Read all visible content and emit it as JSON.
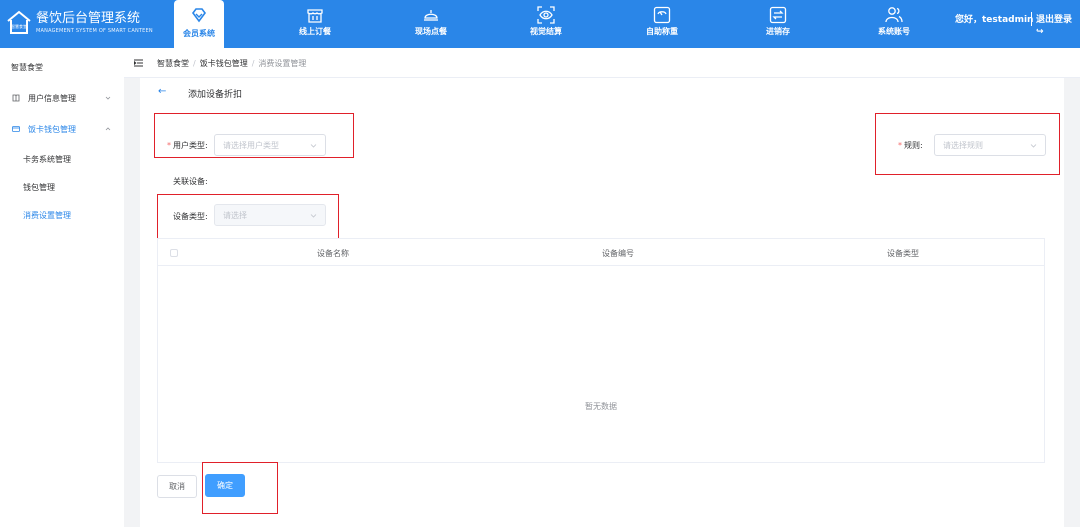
{
  "header": {
    "title": "餐饮后台管理系统",
    "subtitle": "MANAGEMENT SYSTEM OF SMART CANTEEN",
    "logo_text": "智慧食堂",
    "nav": [
      {
        "label": "会员系统",
        "icon": "diamond-icon",
        "active": true
      },
      {
        "label": "线上订餐",
        "icon": "shop-icon"
      },
      {
        "label": "现场点餐",
        "icon": "cloche-icon"
      },
      {
        "label": "视觉结算",
        "icon": "eye-scan-icon"
      },
      {
        "label": "自助称重",
        "icon": "scale-icon"
      },
      {
        "label": "进销存",
        "icon": "exchange-icon"
      },
      {
        "label": "系统账号",
        "icon": "users-icon"
      }
    ],
    "greeting": "您好，testadmin",
    "logout": "退出登录"
  },
  "sidebar": {
    "title": "智慧食堂",
    "items": [
      {
        "label": "用户信息管理",
        "icon": "book-icon",
        "expanded": false
      },
      {
        "label": "饭卡钱包管理",
        "icon": "card-icon",
        "expanded": true
      }
    ],
    "sub_items": [
      "卡务系统管理",
      "钱包管理",
      "消费设置管理"
    ],
    "active_sub": "消费设置管理"
  },
  "breadcrumb": [
    "智慧食堂",
    "饭卡钱包管理",
    "消费设置管理"
  ],
  "page": {
    "title": "添加设备折扣",
    "user_type_label": "用户类型:",
    "user_type_placeholder": "请选择用户类型",
    "rule_label": "规则:",
    "rule_placeholder": "请选择规则",
    "related_devices_label": "关联设备:",
    "device_type_label": "设备类型:",
    "device_type_placeholder": "请选择"
  },
  "table": {
    "columns": [
      "设备名称",
      "设备编号",
      "设备类型"
    ],
    "rows": [],
    "empty_text": "暂无数据"
  },
  "actions": {
    "cancel": "取消",
    "confirm": "确定"
  },
  "colors": {
    "primary": "#2a86e8",
    "button": "#409eff",
    "highlight": "#e0202a",
    "required": "#f56c6c"
  }
}
